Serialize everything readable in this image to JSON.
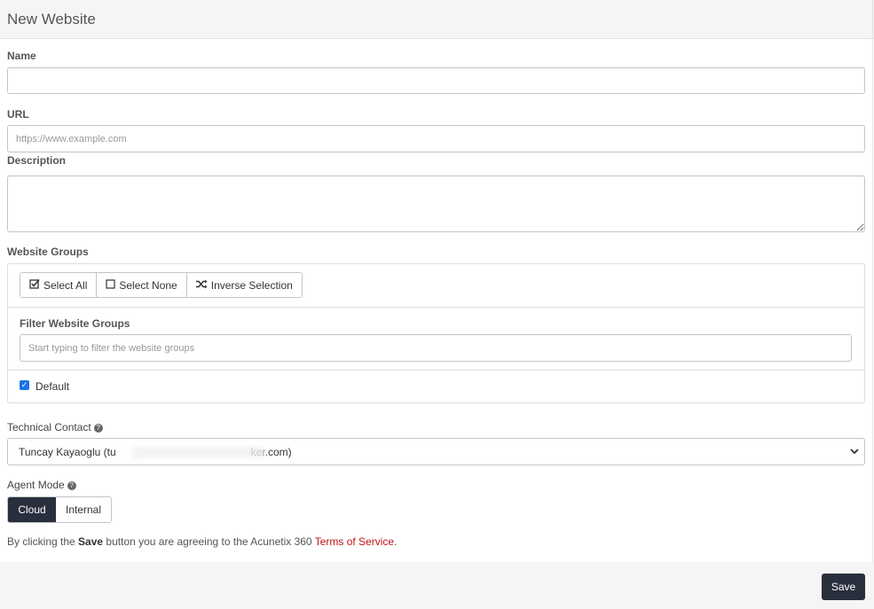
{
  "header": {
    "title": "New Website"
  },
  "form": {
    "name": {
      "label": "Name",
      "value": "",
      "placeholder": ""
    },
    "url": {
      "label": "URL",
      "value": "",
      "placeholder": "https://www.example.com"
    },
    "description": {
      "label": "Description",
      "value": ""
    },
    "website_groups": {
      "label": "Website Groups",
      "buttons": {
        "select_all": "Select All",
        "select_none": "Select None",
        "inverse_selection": "Inverse Selection"
      },
      "filter": {
        "label": "Filter Website Groups",
        "placeholder": "Start typing to filter the website groups"
      },
      "groups": [
        {
          "label": "Default",
          "checked": true
        }
      ]
    },
    "technical_contact": {
      "label": "Technical Contact",
      "selected": "Tuncay Kayaoglu (tu",
      "selected_tail": "ker.com)"
    },
    "agent_mode": {
      "label": "Agent Mode",
      "options": [
        "Cloud",
        "Internal"
      ],
      "selected": "Cloud"
    }
  },
  "terms": {
    "prefix": "By clicking the",
    "bold": "Save",
    "middle": "button you are agreeing to the Acunetix 360",
    "link": "Terms of Service",
    "suffix": "."
  },
  "footer": {
    "save_label": "Save"
  },
  "colors": {
    "primary_dark": "#2a2f3e",
    "link_red": "#c0131b",
    "checkbox_blue": "#1a73e8"
  },
  "icons": {
    "select_all": "check-square-icon",
    "select_none": "square-icon",
    "inverse": "shuffle-icon",
    "help": "question-circle-icon",
    "select_arrow": "chevron-down-icon"
  }
}
